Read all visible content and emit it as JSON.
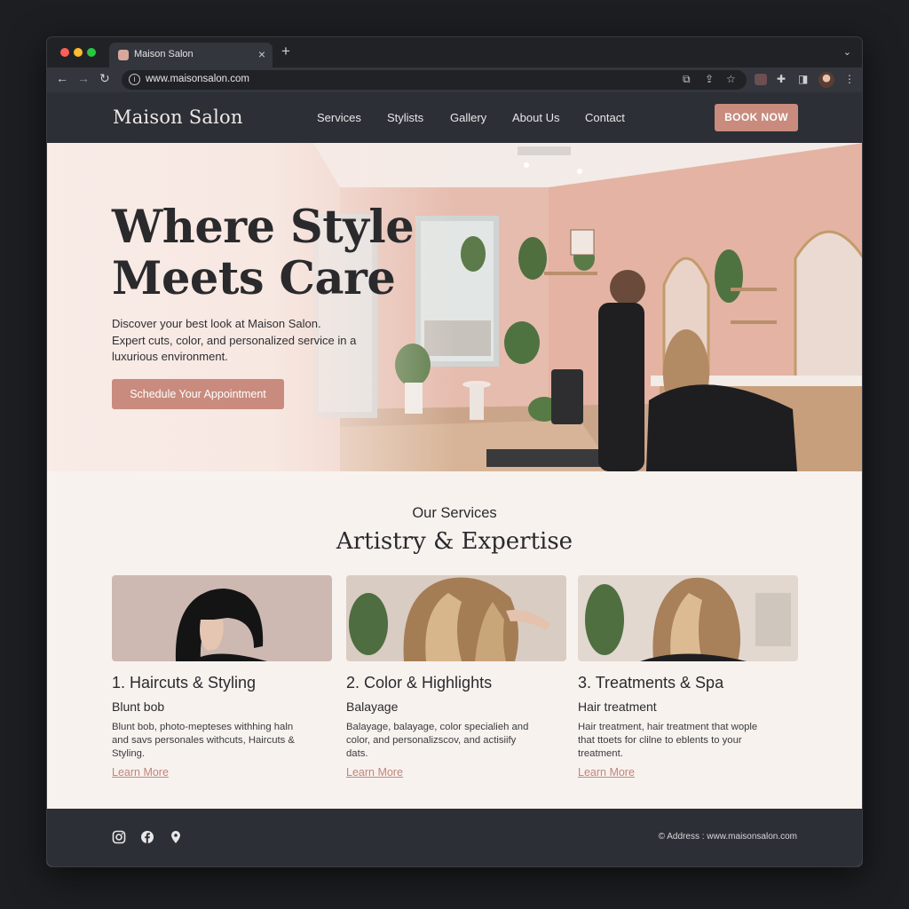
{
  "browser": {
    "tab_title": "Maison Salon",
    "tab_close": "×",
    "new_tab": "+",
    "tab_menu": "⌄",
    "url": "www.maisonsalon.com",
    "back": "←",
    "forward": "→",
    "reload": "↻",
    "info": "i",
    "translate_icon": "⧉",
    "share_icon": "⇪",
    "star_icon": "☆",
    "puzzle_icon": "✚",
    "sidepanel_icon": "◨",
    "menu_icon": "⋮"
  },
  "nav": {
    "logo": "Maison Salon",
    "links": [
      "Services",
      "Stylists",
      "Gallery",
      "About Us",
      "Contact"
    ],
    "cta": "BOOK NOW"
  },
  "hero": {
    "title_line1": "Where Style",
    "title_line2": "Meets Care",
    "subtitle_lines": [
      "Discover your best look at Maison Salon.",
      "Expert cuts, color, and personalized service in a",
      "luxurious environment."
    ],
    "cta": "Schedule Your Appointment"
  },
  "services": {
    "kicker": "Our Services",
    "title": "Artistry & Expertise",
    "cards": [
      {
        "title": "1. Haircuts & Styling",
        "subtitle": "Blunt bob",
        "desc_lines": [
          "Blunt bob, photo-mepteses withhing haln",
          "and savs personales withcuts, Haircuts &",
          "Styling."
        ],
        "link": "Learn More"
      },
      {
        "title": "2. Color & Highlights",
        "subtitle": "Balayage",
        "desc_lines": [
          "Balayage, balayage, color specialieh and",
          "color, and personalizscov, and actisiify",
          "dats."
        ],
        "link": "Learn More"
      },
      {
        "title": "3. Treatments & Spa",
        "subtitle": "Hair treatment",
        "desc_lines": [
          "Hair treatment, hair treatment that wople",
          "that ttoets for clilne to eblents to your",
          "treatment."
        ],
        "link": "Learn More"
      }
    ]
  },
  "footer": {
    "address": "© Address : www.maisonsalon.com"
  },
  "colors": {
    "accent": "#c88b7e",
    "nav_bg": "#2c2f35",
    "page_bg": "#f8f2ef"
  }
}
